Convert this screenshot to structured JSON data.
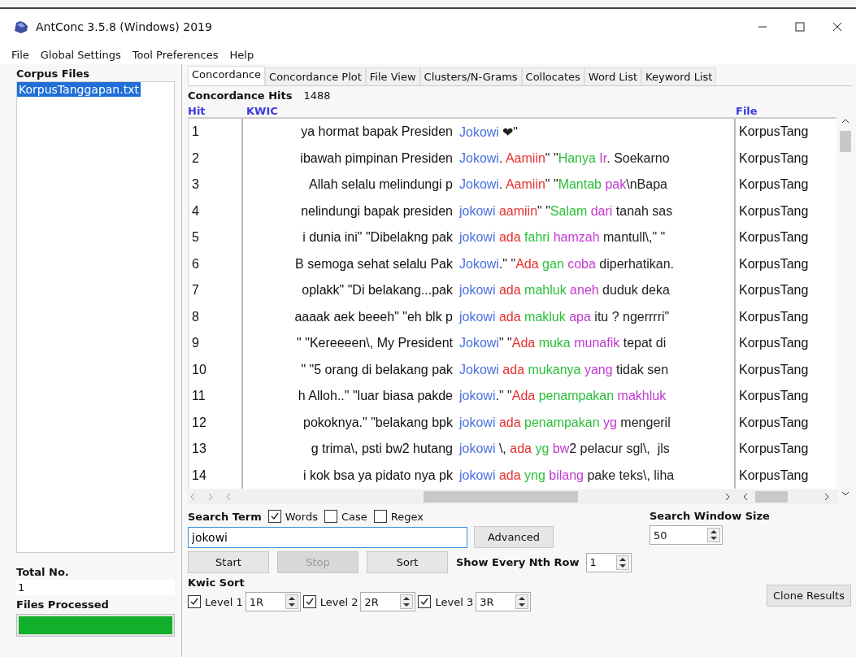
{
  "window": {
    "title": "AntConc 3.5.8 (Windows) 2019"
  },
  "menu": [
    "File",
    "Global Settings",
    "Tool Preferences",
    "Help"
  ],
  "sidebar": {
    "heading": "Corpus Files",
    "files": [
      {
        "name": "KorpusTanggapan.txt",
        "selected": true
      }
    ],
    "total_label": "Total No.",
    "total": "1",
    "processed_label": "Files Processed",
    "progress": {
      "level": 1
    }
  },
  "tabs": [
    {
      "label": "Concordance",
      "selected": true
    },
    {
      "label": "Concordance Plot",
      "selected": false
    },
    {
      "label": "File View",
      "selected": false
    },
    {
      "label": "Clusters/N-Grams",
      "selected": false
    },
    {
      "label": "Collocates",
      "selected": false
    },
    {
      "label": "Word List",
      "selected": false
    },
    {
      "label": "Keyword List",
      "selected": false
    }
  ],
  "hits": {
    "label": "Concordance Hits",
    "value": "1488"
  },
  "table": {
    "columns": [
      "Hit",
      "KWIC",
      "File"
    ],
    "rows": [
      {
        "hit": "1",
        "left": "ya hormat bapak Presiden",
        "right": [
          {
            "kind": "kw",
            "text": "Jokowi"
          },
          {
            "kind": "plain",
            "text": " ❤\""
          }
        ],
        "file": "KorpusTang"
      },
      {
        "hit": "2",
        "left": "ibawah pimpinan Presiden",
        "right": [
          {
            "kind": "kw",
            "text": "Jokowi"
          },
          {
            "kind": "plain",
            "text": ". "
          },
          {
            "kind": "r1",
            "text": "Aamiin"
          },
          {
            "kind": "plain",
            "text": "\" \""
          },
          {
            "kind": "r2",
            "text": "Hanya "
          },
          {
            "kind": "r3",
            "text": "Ir"
          },
          {
            "kind": "plain",
            "text": ". Soekarno"
          }
        ],
        "file": "KorpusTang"
      },
      {
        "hit": "3",
        "left": "Allah selalu melindungi p",
        "right": [
          {
            "kind": "kw",
            "text": "Jokowi"
          },
          {
            "kind": "plain",
            "text": ". "
          },
          {
            "kind": "r1",
            "text": "Aamiin"
          },
          {
            "kind": "plain",
            "text": "\" \""
          },
          {
            "kind": "r2",
            "text": "Mantab "
          },
          {
            "kind": "r3",
            "text": "pak"
          },
          {
            "kind": "plain",
            "text": "\\nBapa"
          }
        ],
        "file": "KorpusTang"
      },
      {
        "hit": "4",
        "left": "nelindungi bapak presiden",
        "right": [
          {
            "kind": "kw",
            "text": "jokowi "
          },
          {
            "kind": "r1",
            "text": "aamiin"
          },
          {
            "kind": "plain",
            "text": "\" \""
          },
          {
            "kind": "r2",
            "text": "Salam "
          },
          {
            "kind": "r3",
            "text": "dari"
          },
          {
            "kind": "plain",
            "text": " tanah sas"
          }
        ],
        "file": "KorpusTang"
      },
      {
        "hit": "5",
        "left": "i dunia ini\" \"Dibelakng pak",
        "right": [
          {
            "kind": "kw",
            "text": "jokowi "
          },
          {
            "kind": "r1",
            "text": "ada "
          },
          {
            "kind": "r2",
            "text": "fahri "
          },
          {
            "kind": "r3",
            "text": "hamzah"
          },
          {
            "kind": "plain",
            "text": " mantull\\,\" \""
          }
        ],
        "file": "KorpusTang"
      },
      {
        "hit": "6",
        "left": "B semoga sehat selalu Pak",
        "right": [
          {
            "kind": "kw",
            "text": "Jokowi"
          },
          {
            "kind": "plain",
            "text": ".\" \""
          },
          {
            "kind": "r1",
            "text": "Ada "
          },
          {
            "kind": "r2",
            "text": "gan "
          },
          {
            "kind": "r3",
            "text": "coba"
          },
          {
            "kind": "plain",
            "text": " diperhatikan."
          }
        ],
        "file": "KorpusTang"
      },
      {
        "hit": "7",
        "left": "oplakk\" \"Di belakang...pak",
        "right": [
          {
            "kind": "kw",
            "text": "jokowi "
          },
          {
            "kind": "r1",
            "text": "ada "
          },
          {
            "kind": "r2",
            "text": "mahluk "
          },
          {
            "kind": "r3",
            "text": "aneh"
          },
          {
            "kind": "plain",
            "text": " duduk deka"
          }
        ],
        "file": "KorpusTang"
      },
      {
        "hit": "8",
        "left": "aaaak aek beeeh\" \"eh blk p",
        "right": [
          {
            "kind": "kw",
            "text": "jokowi "
          },
          {
            "kind": "r1",
            "text": "ada "
          },
          {
            "kind": "r2",
            "text": "makluk "
          },
          {
            "kind": "r3",
            "text": "apa"
          },
          {
            "kind": "plain",
            "text": " itu ? ngerrrri\""
          }
        ],
        "file": "KorpusTang"
      },
      {
        "hit": "9",
        "left": "\" \"Kereeeen\\, My President",
        "right": [
          {
            "kind": "kw",
            "text": "Jokowi"
          },
          {
            "kind": "plain",
            "text": "\" \""
          },
          {
            "kind": "r1",
            "text": "Ada "
          },
          {
            "kind": "r2",
            "text": "muka "
          },
          {
            "kind": "r3",
            "text": "munafik"
          },
          {
            "kind": "plain",
            "text": " tepat di"
          }
        ],
        "file": "KorpusTang"
      },
      {
        "hit": "10",
        "left": "\" \"5 orang di belakang pak",
        "right": [
          {
            "kind": "kw",
            "text": "Jokowi "
          },
          {
            "kind": "r1",
            "text": "ada "
          },
          {
            "kind": "r2",
            "text": "mukanya "
          },
          {
            "kind": "r3",
            "text": "yang"
          },
          {
            "kind": "plain",
            "text": " tidak sen"
          }
        ],
        "file": "KorpusTang"
      },
      {
        "hit": "11",
        "left": "h Alloh..\" \"luar biasa pakde",
        "right": [
          {
            "kind": "kw",
            "text": "jokowi"
          },
          {
            "kind": "plain",
            "text": ".\" \""
          },
          {
            "kind": "r1",
            "text": "Ada "
          },
          {
            "kind": "r2",
            "text": "penampakan "
          },
          {
            "kind": "r3",
            "text": "makhluk"
          }
        ],
        "file": "KorpusTang"
      },
      {
        "hit": "12",
        "left": "pokoknya.\" \"belakang bpk",
        "right": [
          {
            "kind": "kw",
            "text": "jokowi "
          },
          {
            "kind": "r1",
            "text": "ada "
          },
          {
            "kind": "r2",
            "text": "penampakan "
          },
          {
            "kind": "r3",
            "text": "yg"
          },
          {
            "kind": "plain",
            "text": " mengeril"
          }
        ],
        "file": "KorpusTang"
      },
      {
        "hit": "13",
        "left": "g trima\\, psti bw2 hutang",
        "right": [
          {
            "kind": "kw",
            "text": "jokowi"
          },
          {
            "kind": "plain",
            "text": " \\, "
          },
          {
            "kind": "r1",
            "text": "ada "
          },
          {
            "kind": "r2",
            "text": "yg "
          },
          {
            "kind": "r3",
            "text": "bw"
          },
          {
            "kind": "plain",
            "text": "2 pelacur sgl\\,  jls"
          }
        ],
        "file": "KorpusTang"
      },
      {
        "hit": "14",
        "left": "i kok bsa ya pidato nya pk",
        "right": [
          {
            "kind": "kw",
            "text": "jokowi "
          },
          {
            "kind": "r1",
            "text": "ada "
          },
          {
            "kind": "r2",
            "text": "yng "
          },
          {
            "kind": "r3",
            "text": "bilang"
          },
          {
            "kind": "plain",
            "text": " pake teks\\, liha"
          }
        ],
        "file": "KorpusTang"
      }
    ]
  },
  "search": {
    "label": "Search Term",
    "options": [
      {
        "label": "Words",
        "checked": true
      },
      {
        "label": "Case",
        "checked": false
      },
      {
        "label": "Regex",
        "checked": false
      }
    ],
    "value": "jokowi",
    "advanced": "Advanced",
    "window_label": "Search Window Size",
    "window_value": "50",
    "buttons": [
      {
        "label": "Start",
        "disabled": false
      },
      {
        "label": "Stop",
        "disabled": true
      },
      {
        "label": "Sort",
        "disabled": false
      }
    ],
    "nth_label": "Show Every Nth Row",
    "nth_value": "1"
  },
  "kwic_sort": {
    "label": "Kwic Sort",
    "levels": [
      {
        "label": "Level 1",
        "checked": true,
        "value": "1R"
      },
      {
        "label": "Level 2",
        "checked": true,
        "value": "2R"
      },
      {
        "label": "Level 3",
        "checked": true,
        "value": "3R"
      }
    ]
  },
  "clone": "Clone Results"
}
